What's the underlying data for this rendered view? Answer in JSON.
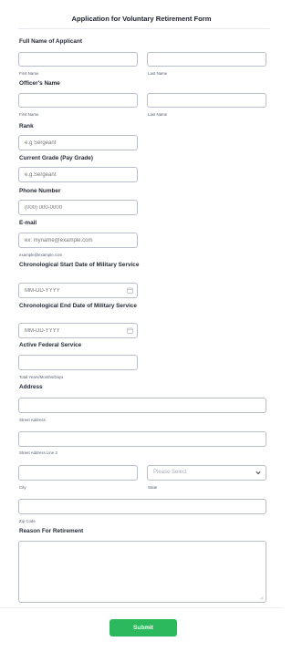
{
  "form": {
    "title": "Application for Voluntary Retirement Form",
    "full_name": {
      "label": "Full Name of Applicant",
      "first_sublabel": "First Name",
      "last_sublabel": "Last Name",
      "first_value": "",
      "last_value": ""
    },
    "officer_name": {
      "label": "Officer's Name",
      "first_sublabel": "First Name",
      "last_sublabel": "Last Name",
      "first_value": "",
      "last_value": ""
    },
    "rank": {
      "label": "Rank",
      "placeholder": "e.g Sergeant"
    },
    "grade": {
      "label": "Current Grade (Pay Grade)",
      "placeholder": "e.g.Sergeant"
    },
    "phone": {
      "label": "Phone Number",
      "placeholder": "(000) 000-0000"
    },
    "email": {
      "label": "E-mail",
      "placeholder": "ex: myname@example.com",
      "sublabel": "example@example.com"
    },
    "start_date": {
      "label": "Chronological Start Date of Military Service",
      "placeholder": "MM-DD-YYYY"
    },
    "end_date": {
      "label": "Chronological End Date of Military Service",
      "placeholder": "MM-DD-YYYY"
    },
    "federal_service": {
      "label": "Active Federal Service",
      "sublabel": "Total Years/Months/Days"
    },
    "address": {
      "label": "Address",
      "street_sublabel": "Street Address",
      "street2_sublabel": "Street Address Line 2",
      "city_sublabel": "City",
      "state_sublabel": "State",
      "state_placeholder": "Please Select",
      "zip_sublabel": "Zip Code"
    },
    "reason": {
      "label": "Reason For Retirement"
    },
    "submit_label": "Submit"
  }
}
